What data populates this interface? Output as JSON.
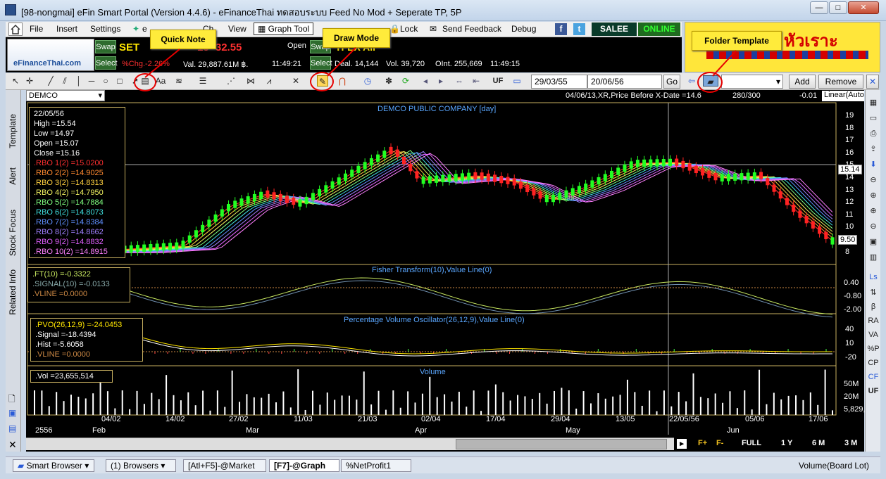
{
  "window": {
    "title": "[98-nongmai] eFin Smart Portal (Version 4.4.6) - eFinanceThai ทดสอบระบบ Feed No Mod + Seperate TP, 5P",
    "min": "—",
    "max": "□",
    "close": "✕"
  },
  "menu": {
    "file": "File",
    "insert": "Insert",
    "settings": "Settings",
    "ecal": "e",
    "chart": "Ch",
    "view": "View",
    "graph_tool": "Graph Tool",
    "lock": "Lock",
    "feedback": "Send Feedback",
    "debug": "Debug",
    "salee": "SALEE",
    "online": "ONLINE"
  },
  "banner": {
    "logo": "eFinanceThai.com",
    "swap1": "Swap",
    "select1": "Select",
    "index": "SET",
    "index_val": "15 -32.55",
    "pct": "%Chg.-2.26%",
    "value": "Val. 29,887.61M ฿.",
    "time1": "11:49:21",
    "open": "Open",
    "swap2": "Swap",
    "select2": "Select",
    "tfex": "TFEX All",
    "deal": "Deal. 14,144",
    "vol": "Vol. 39,720",
    "oint": "OInt. 255,669",
    "time2": "11:49:15"
  },
  "ad": {
    "text": "หัวเราะ"
  },
  "toolbar": {
    "date_from": "29/03/55",
    "date_to": "20/06/56",
    "go": "Go",
    "uf": "UF",
    "add": "Add",
    "remove": "Remove"
  },
  "callouts": {
    "quick_note": "Quick Note",
    "draw_mode": "Draw Mode",
    "folder_template": "Folder Template"
  },
  "chart_header": {
    "symbol": "DEMCO",
    "note": "04/06/13,XR,Price Before X-Date =14.6",
    "count": "280/300",
    "chg": "-0.01",
    "scale": "Linear(Auto"
  },
  "price_panel": {
    "title": "DEMCO PUBLIC COMPANY [day]",
    "date": "22/05/56",
    "high": "High  =15.54",
    "low": "Low   =14.97",
    "open": "Open  =15.07",
    "close": "Close  =15.16",
    "rbo": [
      ".RBO 1(2)   =15.0200",
      ".RBO 2(2)   =14.9025",
      ".RBO 3(2)   =14.8313",
      ".RBO 4(2)   =14.7950",
      ".RBO 5(2)   =14.7884",
      ".RBO 6(2)   =14.8073",
      ".RBO 7(2)   =14.8384",
      ".RBO 8(2)   =14.8662",
      ".RBO 9(2)   =14.8832",
      ".RBO 10(2)  =14.8915"
    ],
    "rbo_colors": [
      "#ff3030",
      "#ff8a30",
      "#ffd040",
      "#f0f060",
      "#80ff80",
      "#40e0e0",
      "#6090ff",
      "#a080ff",
      "#e060ff",
      "#ff80ff"
    ],
    "yticks": [
      "19",
      "18",
      "17",
      "16",
      "15",
      "14",
      "13",
      "12",
      "11",
      "10",
      "9",
      "8"
    ],
    "last": "15.14",
    "low_tag": "9.50"
  },
  "fisher_panel": {
    "title": "Fisher Transform(10),Value Line(0)",
    "ft": ".FT(10)   =-0.3322",
    "signal": ".SIGNAL(10)   =-0.0133",
    "vline": ".VLINE   =0.0000",
    "yticks": [
      "0.40",
      "-0.80",
      "-2.00"
    ]
  },
  "pvo_panel": {
    "title": "Percentage Volume Oscillator(26,12,9),Value Line(0)",
    "pvo": ".PVO(26,12,9)   =-24.0453",
    "signal": ".Signal   =-18.4394",
    "hist": ".Hist   =-5.6058",
    "vline": ".VLINE   =0.0000",
    "yticks": [
      "40",
      "10",
      "-20"
    ]
  },
  "vol_panel": {
    "title": "Volume",
    "vol": ".Vol   =23,655,514",
    "yticks": [
      "50M",
      "20M",
      "5,829,9"
    ]
  },
  "xaxis": {
    "dates": [
      "04/02",
      "14/02",
      "27/02",
      "11/03",
      "21/03",
      "02/04",
      "17/04",
      "29/04",
      "13/05",
      "22/05/56",
      "05/06",
      "17/06"
    ],
    "months": [
      "2556",
      "Feb",
      "Mar",
      "Apr",
      "May",
      "Jun"
    ]
  },
  "timeframes": {
    "full": "FULL",
    "y1": "1 Y",
    "m6": "6 M",
    "m3": "3 M"
  },
  "lefttabs": [
    "Template",
    "Alert",
    "Stock Focus",
    "Related Info"
  ],
  "righttools": [
    "β",
    "RA",
    "VA",
    "%P",
    "CP",
    "CF",
    "UF"
  ],
  "statusbar": {
    "smart_browser": "Smart Browser",
    "browsers": "(1) Browsers",
    "tab1": "[Atl+F5]-@Market",
    "tab2": "[F7]-@Graph",
    "tab3": "%NetProfit1",
    "right": "Volume(Board Lot)"
  }
}
